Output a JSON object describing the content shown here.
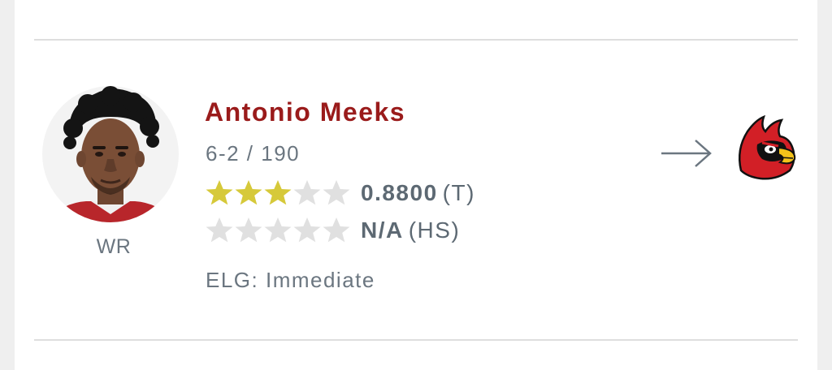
{
  "player": {
    "name": "Antonio Meeks",
    "position": "WR",
    "measurables": "6-2 / 190",
    "eligibility": "ELG: Immediate"
  },
  "ratings": [
    {
      "stars_filled": 3,
      "stars_total": 5,
      "value": "0.8800",
      "suffix": "(T)"
    },
    {
      "stars_filled": 0,
      "stars_total": 5,
      "value": "N/A",
      "suffix": "(HS)"
    }
  ],
  "icons": {
    "arrow": "right-arrow-icon",
    "team_logo": "cardinal-logo",
    "avatar": "player-photo"
  },
  "colors": {
    "name": "#9a1b1b",
    "star_filled": "#d6c93a",
    "star_empty": "#e0e0e0",
    "text_muted": "#6b7680",
    "divider": "#dedede"
  }
}
